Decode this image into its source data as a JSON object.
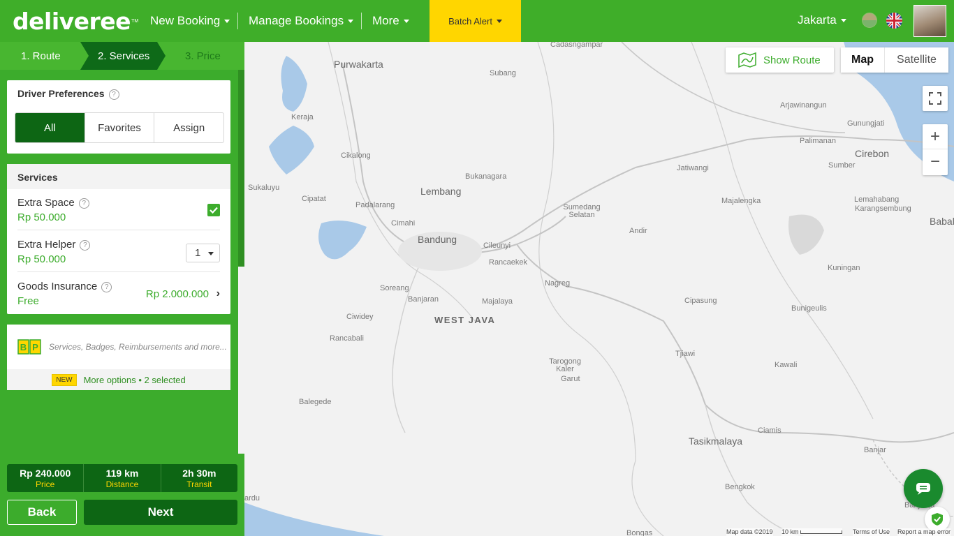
{
  "header": {
    "logo_text": "deliveree",
    "nav": [
      {
        "label": "New Booking"
      },
      {
        "label": "Manage Bookings"
      },
      {
        "label": "More"
      }
    ],
    "batch_alert": "Batch Alert",
    "city": "Jakarta"
  },
  "steps": [
    {
      "label": "1. Route"
    },
    {
      "label": "2. Services"
    },
    {
      "label": "3. Price"
    }
  ],
  "driver_preferences": {
    "title": "Driver Preferences",
    "options": [
      "All",
      "Favorites",
      "Assign"
    ],
    "selected": "All"
  },
  "services": {
    "title": "Services",
    "items": [
      {
        "name": "Extra Space",
        "price": "Rp 50.000",
        "checked": true
      },
      {
        "name": "Extra Helper",
        "price": "Rp 50.000",
        "quantity": "1"
      },
      {
        "name": "Goods Insurance",
        "price": "Free",
        "value": "Rp 2.000.000"
      }
    ]
  },
  "bp": {
    "logo": "BP",
    "description": "Services, Badges, Reimbursements and more...",
    "badge": "NEW",
    "more_options": "More options • 2 selected"
  },
  "summary": [
    {
      "value": "Rp 240.000",
      "label": "Price"
    },
    {
      "value": "119 km",
      "label": "Distance"
    },
    {
      "value": "2h 30m",
      "label": "Transit"
    }
  ],
  "buttons": {
    "back": "Back",
    "next": "Next"
  },
  "map": {
    "show_route": "Show Route",
    "type_map": "Map",
    "type_satellite": "Satellite",
    "places": [
      "Cadasngampar",
      "Purwakarta",
      "Subang",
      "Arjawinangun",
      "Gunungjati",
      "Palimanan",
      "Cirebon",
      "Sumber",
      "Keraja",
      "Cikalong",
      "Bukanagara",
      "Jatiwangi",
      "Majalengka",
      "Lemahabang",
      "Karangsembung",
      "Babal",
      "Sukaluyu",
      "Cipatat",
      "Padalarang",
      "Lembang",
      "Sumedang Selatan",
      "Cimahi",
      "Bandung",
      "Cileunyi",
      "Andir",
      "Rancaekek",
      "Kuningan",
      "Soreang",
      "Nagreg",
      "Banjaran",
      "Majalaya",
      "Cipasung",
      "Bunigeulis",
      "Ciwidey",
      "WEST JAVA",
      "Rancabali",
      "Tjiawi",
      "Kawali",
      "Tarogong Kaler",
      "Garut",
      "Balegede",
      "Ciamis",
      "Tasikmalaya",
      "Banjar",
      "Bengkok",
      "Banjarsa",
      "Bongas",
      "ardu"
    ],
    "attribution": {
      "data": "Map data ©2019",
      "scale": "10 km",
      "terms": "Terms of Use",
      "report": "Report a map error"
    }
  },
  "colors": {
    "brand_green": "#3fae29",
    "dark_green": "#0d6614",
    "batch_yellow": "#ffd600"
  }
}
